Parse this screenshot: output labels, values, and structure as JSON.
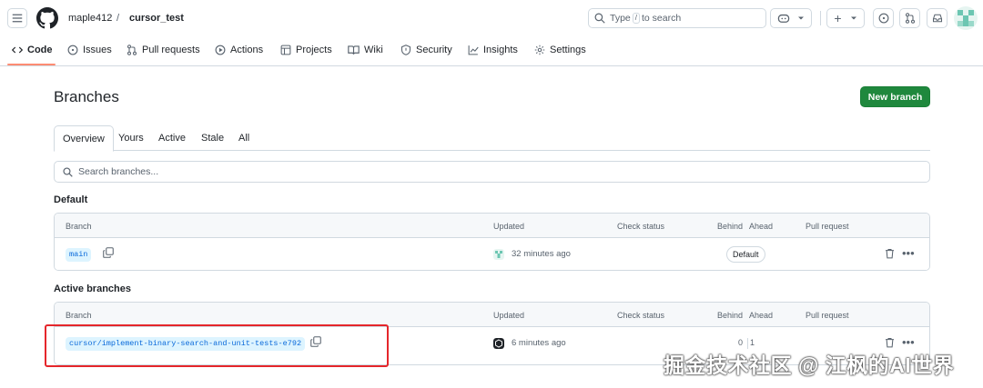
{
  "header": {
    "owner": "maple412",
    "separator": "/",
    "repo": "cursor_test",
    "search_prefix": "Type",
    "search_key": "/",
    "search_suffix": "to search",
    "plus_label": "+"
  },
  "repo_nav": {
    "items": [
      {
        "label": "Code",
        "icon": "code-icon",
        "active": true
      },
      {
        "label": "Issues",
        "icon": "issue-icon"
      },
      {
        "label": "Pull requests",
        "icon": "pull-request-icon"
      },
      {
        "label": "Actions",
        "icon": "actions-icon"
      },
      {
        "label": "Projects",
        "icon": "projects-icon"
      },
      {
        "label": "Wiki",
        "icon": "wiki-icon"
      },
      {
        "label": "Security",
        "icon": "shield-icon"
      },
      {
        "label": "Insights",
        "icon": "graph-icon"
      },
      {
        "label": "Settings",
        "icon": "gear-icon"
      }
    ]
  },
  "page": {
    "title": "Branches",
    "new_branch_label": "New branch"
  },
  "tabs": [
    "Overview",
    "Yours",
    "Active",
    "Stale",
    "All"
  ],
  "search_branches": {
    "placeholder": "Search branches..."
  },
  "default_section": {
    "label": "Default",
    "columns": {
      "branch": "Branch",
      "updated": "Updated",
      "check_status": "Check status",
      "behind": "Behind",
      "ahead": "Ahead",
      "pull_request": "Pull request"
    },
    "rows": [
      {
        "name": "main",
        "updated": "32 minutes ago",
        "badge": "Default"
      }
    ]
  },
  "active_section": {
    "label": "Active branches",
    "columns": {
      "branch": "Branch",
      "updated": "Updated",
      "check_status": "Check status",
      "behind": "Behind",
      "ahead": "Ahead",
      "pull_request": "Pull request"
    },
    "rows": [
      {
        "name": "cursor/implement-binary-search-and-unit-tests-e792",
        "updated": "6 minutes ago",
        "behind": "0",
        "ahead": "1"
      }
    ]
  },
  "watermark": "掘金技术社区 @ 江枫的AI世界",
  "colors": {
    "primary_button": "#1f883d",
    "branch_chip_bg": "#ddf4ff",
    "branch_chip_text": "#0969da",
    "highlight": "#e5262b",
    "nav_underline": "#fd8c73"
  }
}
